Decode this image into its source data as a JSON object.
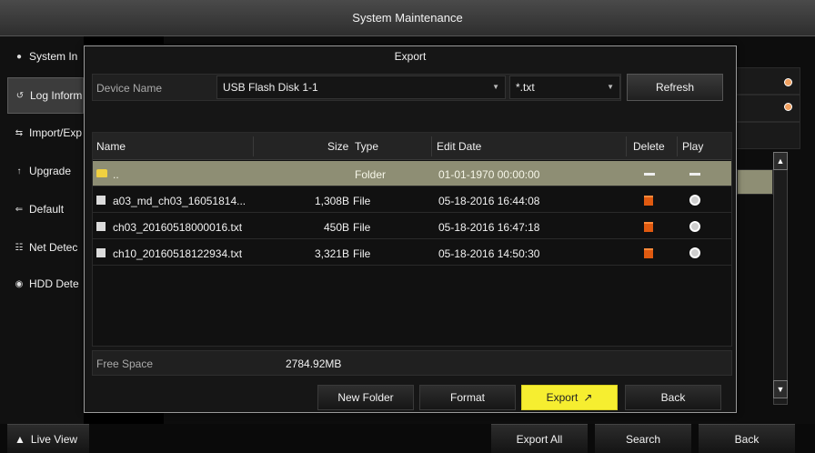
{
  "window": {
    "title": "System Maintenance"
  },
  "sidebar": {
    "items": [
      {
        "label": "System In",
        "icon": "info-icon"
      },
      {
        "label": "Log Inform",
        "icon": "log-icon"
      },
      {
        "label": "Import/Exp",
        "icon": "import-export-icon"
      },
      {
        "label": "Upgrade",
        "icon": "upgrade-icon"
      },
      {
        "label": "Default",
        "icon": "default-icon"
      },
      {
        "label": "Net Detec",
        "icon": "network-icon"
      },
      {
        "label": "HDD Dete",
        "icon": "hdd-icon"
      }
    ]
  },
  "dialog": {
    "title": "Export",
    "device_label": "Device Name",
    "device_value": "USB Flash Disk 1-1",
    "filter_value": "*.txt",
    "refresh_label": "Refresh",
    "columns": {
      "name": "Name",
      "size": "Size",
      "type": "Type",
      "edit_date": "Edit Date",
      "delete": "Delete",
      "play": "Play"
    },
    "rows": [
      {
        "name": "..",
        "size": "",
        "type": "Folder",
        "date": "01-01-1970 00:00:00",
        "kind": "folder"
      },
      {
        "name": "a03_md_ch03_16051814...",
        "size": "1,308B",
        "type": "File",
        "date": "05-18-2016 16:44:08",
        "kind": "file"
      },
      {
        "name": "ch03_20160518000016.txt",
        "size": "450B",
        "type": "File",
        "date": "05-18-2016 16:47:18",
        "kind": "file"
      },
      {
        "name": "ch10_20160518122934.txt",
        "size": "3,321B",
        "type": "File",
        "date": "05-18-2016 14:50:30",
        "kind": "file"
      }
    ],
    "free_space_label": "Free Space",
    "free_space_value": "2784.92MB",
    "buttons": {
      "new_folder": "New Folder",
      "format": "Format",
      "export": "Export",
      "back": "Back"
    }
  },
  "bottom": {
    "live_view": "Live View",
    "export_all": "Export All",
    "search": "Search",
    "back": "Back"
  },
  "colors": {
    "selected_row": "#8e8e74",
    "highlight_button": "#f6ee30",
    "delete_icon": "#e05a10"
  }
}
